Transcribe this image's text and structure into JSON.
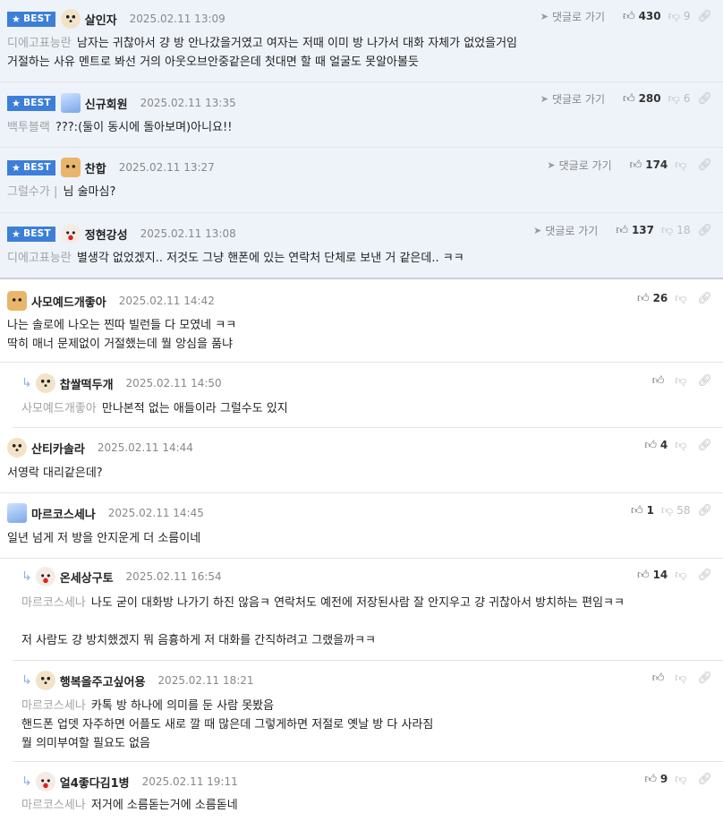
{
  "badge_label": "BEST",
  "reply_link_label": "댓글로 가기",
  "comments": [
    {
      "nick": "살인자",
      "date": "2025.02.11 13:09",
      "up": "430",
      "down": "9",
      "tag": "디에고표능란",
      "lines": [
        "남자는 귀찮아서 걍 방 안나갔을거였고 여자는 저때 이미 방 나가서 대화 자체가 없었을거임",
        "거절하는 사유 멘트로 봐선 거의 아웃오브안중같은데 첫대면 할 때 얼굴도 못알아볼듯"
      ]
    },
    {
      "nick": "신규회원",
      "date": "2025.02.11 13:35",
      "up": "280",
      "down": "6",
      "tag": "백투블랙",
      "lines": [
        "???:(둘이 동시에 돌아보며)아니요!!"
      ]
    },
    {
      "nick": "찬합",
      "date": "2025.02.11 13:27",
      "up": "174",
      "down": "",
      "tag": "그럴수가 |",
      "lines": [
        "님 술마심?"
      ]
    },
    {
      "nick": "정현강성",
      "date": "2025.02.11 13:08",
      "up": "137",
      "down": "18",
      "tag": "디에고표능란",
      "lines": [
        "별생각 없었겠지.. 저것도 그냥 핸폰에 있는 연락처 단체로 보낸 거 같은데.. ㅋㅋ"
      ]
    },
    {
      "nick": "사모예드개좋아",
      "date": "2025.02.11 14:42",
      "up": "26",
      "down": "",
      "tag": "",
      "lines": [
        "나는 솔로에 나오는 찐따 빌런들 다 모였네 ㅋㅋ",
        "딱히 매너 문제없이 거절했는데 뭘 앙심을 품냐"
      ]
    },
    {
      "nick": "찹쌀떡두개",
      "date": "2025.02.11 14:50",
      "up": "",
      "down": "",
      "tag": "사모예드개좋아",
      "lines": [
        "만나본적 없는 애들이라 그럴수도 있지"
      ]
    },
    {
      "nick": "산티카솔라",
      "date": "2025.02.11 14:44",
      "up": "4",
      "down": "",
      "tag": "",
      "lines": [
        "서영락 대리같은데?"
      ]
    },
    {
      "nick": "마르코스세나",
      "date": "2025.02.11 14:45",
      "up": "1",
      "down": "58",
      "tag": "",
      "lines": [
        "일년 넘게 저 방을 안지운게 더 소름이네"
      ]
    },
    {
      "nick": "온세상구토",
      "date": "2025.02.11 16:54",
      "up": "14",
      "down": "",
      "tag": "마르코스세나",
      "lines": [
        "나도 굳이 대화방 나가기 하진 않음ㅋ 연락처도 예전에 저장된사람 잘 안지우고 걍 귀찮아서 방치하는 편임ㅋㅋ",
        "",
        "저 사람도 걍 방치했겠지 뭐 음흉하게 저 대화를 간직하려고 그랬을까ㅋㅋ"
      ]
    },
    {
      "nick": "행복을주고싶어용",
      "date": "2025.02.11 18:21",
      "up": "",
      "down": "",
      "tag": "마르코스세나",
      "lines": [
        "카톡 방 하나에 의미를 둔 사람 못봤음",
        "핸드폰 업뎃 자주하면 어플도 새로 깔 때 많은데 그렇게하면 저절로 옛날 방 다 사라짐",
        "뭘 의미부여할 필요도 없음"
      ]
    },
    {
      "nick": "얼4좋다김1병",
      "date": "2025.02.11 19:11",
      "up": "9",
      "down": "",
      "tag": "마르코스세나",
      "lines": [
        "저거에 소름돋는거에 소름돋네"
      ]
    }
  ]
}
